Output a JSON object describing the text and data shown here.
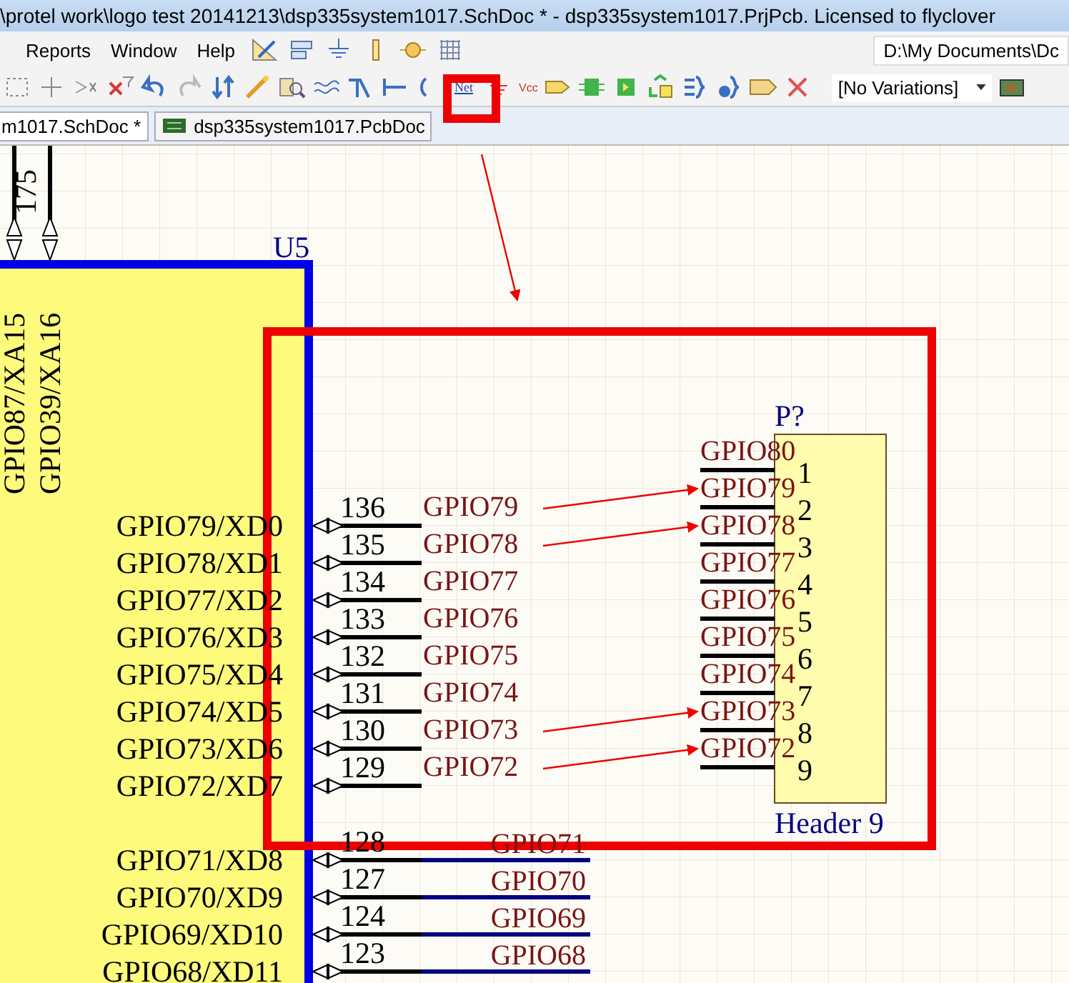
{
  "window": {
    "title": "\\protel work\\logo test 20141213\\dsp335system1017.SchDoc * - dsp335system1017.PrjPcb. Licensed to flyclover"
  },
  "menu": [
    "Reports",
    "Window",
    "Help"
  ],
  "toolbar": {
    "path_field": "D:\\My Documents\\Dc",
    "net_tool_label": "Net",
    "net_tool_highlighted": true,
    "power_tool_label": "Vcc",
    "variations_dropdown": "[No Variations]"
  },
  "tabs": [
    {
      "label": "m1017.SchDoc *",
      "selected": true
    },
    {
      "label": "dsp335system1017.PcbDoc",
      "selected": false
    }
  ],
  "schematic": {
    "u5": {
      "designator": "U5",
      "top_pins": [
        {
          "name": "GPIO87/XA15"
        },
        {
          "number": "175",
          "name": "GPIO39/XA16"
        }
      ],
      "right_pins": [
        {
          "number": "136",
          "name": "GPIO79/XD0",
          "net": "GPIO79",
          "kind": "stub",
          "annotated": true
        },
        {
          "number": "135",
          "name": "GPIO78/XD1",
          "net": "GPIO78",
          "kind": "stub",
          "annotated": true
        },
        {
          "number": "134",
          "name": "GPIO77/XD2",
          "net": "GPIO77",
          "kind": "stub",
          "annotated": false
        },
        {
          "number": "133",
          "name": "GPIO76/XD3",
          "net": "GPIO76",
          "kind": "stub",
          "annotated": false
        },
        {
          "number": "132",
          "name": "GPIO75/XD4",
          "net": "GPIO75",
          "kind": "stub",
          "annotated": false
        },
        {
          "number": "131",
          "name": "GPIO74/XD5",
          "net": "GPIO74",
          "kind": "stub",
          "annotated": false
        },
        {
          "number": "130",
          "name": "GPIO73/XD6",
          "net": "GPIO73",
          "kind": "stub",
          "annotated": true
        },
        {
          "number": "129",
          "name": "GPIO72/XD7",
          "net": "GPIO72",
          "kind": "stub",
          "annotated": true
        },
        {
          "number": "128",
          "name": "GPIO71/XD8",
          "net": "GPIO71",
          "kind": "wire",
          "annotated": false
        },
        {
          "number": "127",
          "name": "GPIO70/XD9",
          "net": "GPIO70",
          "kind": "wire",
          "annotated": false
        },
        {
          "number": "124",
          "name": "GPIO69/XD10",
          "net": "GPIO69",
          "kind": "wire",
          "annotated": false
        },
        {
          "number": "123",
          "name": "GPIO68/XD11",
          "net": "GPIO68",
          "kind": "wire",
          "annotated": false
        }
      ]
    },
    "header": {
      "designator": "P?",
      "comment": "Header 9",
      "pins": [
        {
          "number": "1",
          "net": "GPIO80"
        },
        {
          "number": "2",
          "net": "GPIO79"
        },
        {
          "number": "3",
          "net": "GPIO78"
        },
        {
          "number": "4",
          "net": "GPIO77"
        },
        {
          "number": "5",
          "net": "GPIO76"
        },
        {
          "number": "6",
          "net": "GPIO75"
        },
        {
          "number": "7",
          "net": "GPIO74"
        },
        {
          "number": "8",
          "net": "GPIO73"
        },
        {
          "number": "9",
          "net": "GPIO72"
        }
      ]
    }
  }
}
